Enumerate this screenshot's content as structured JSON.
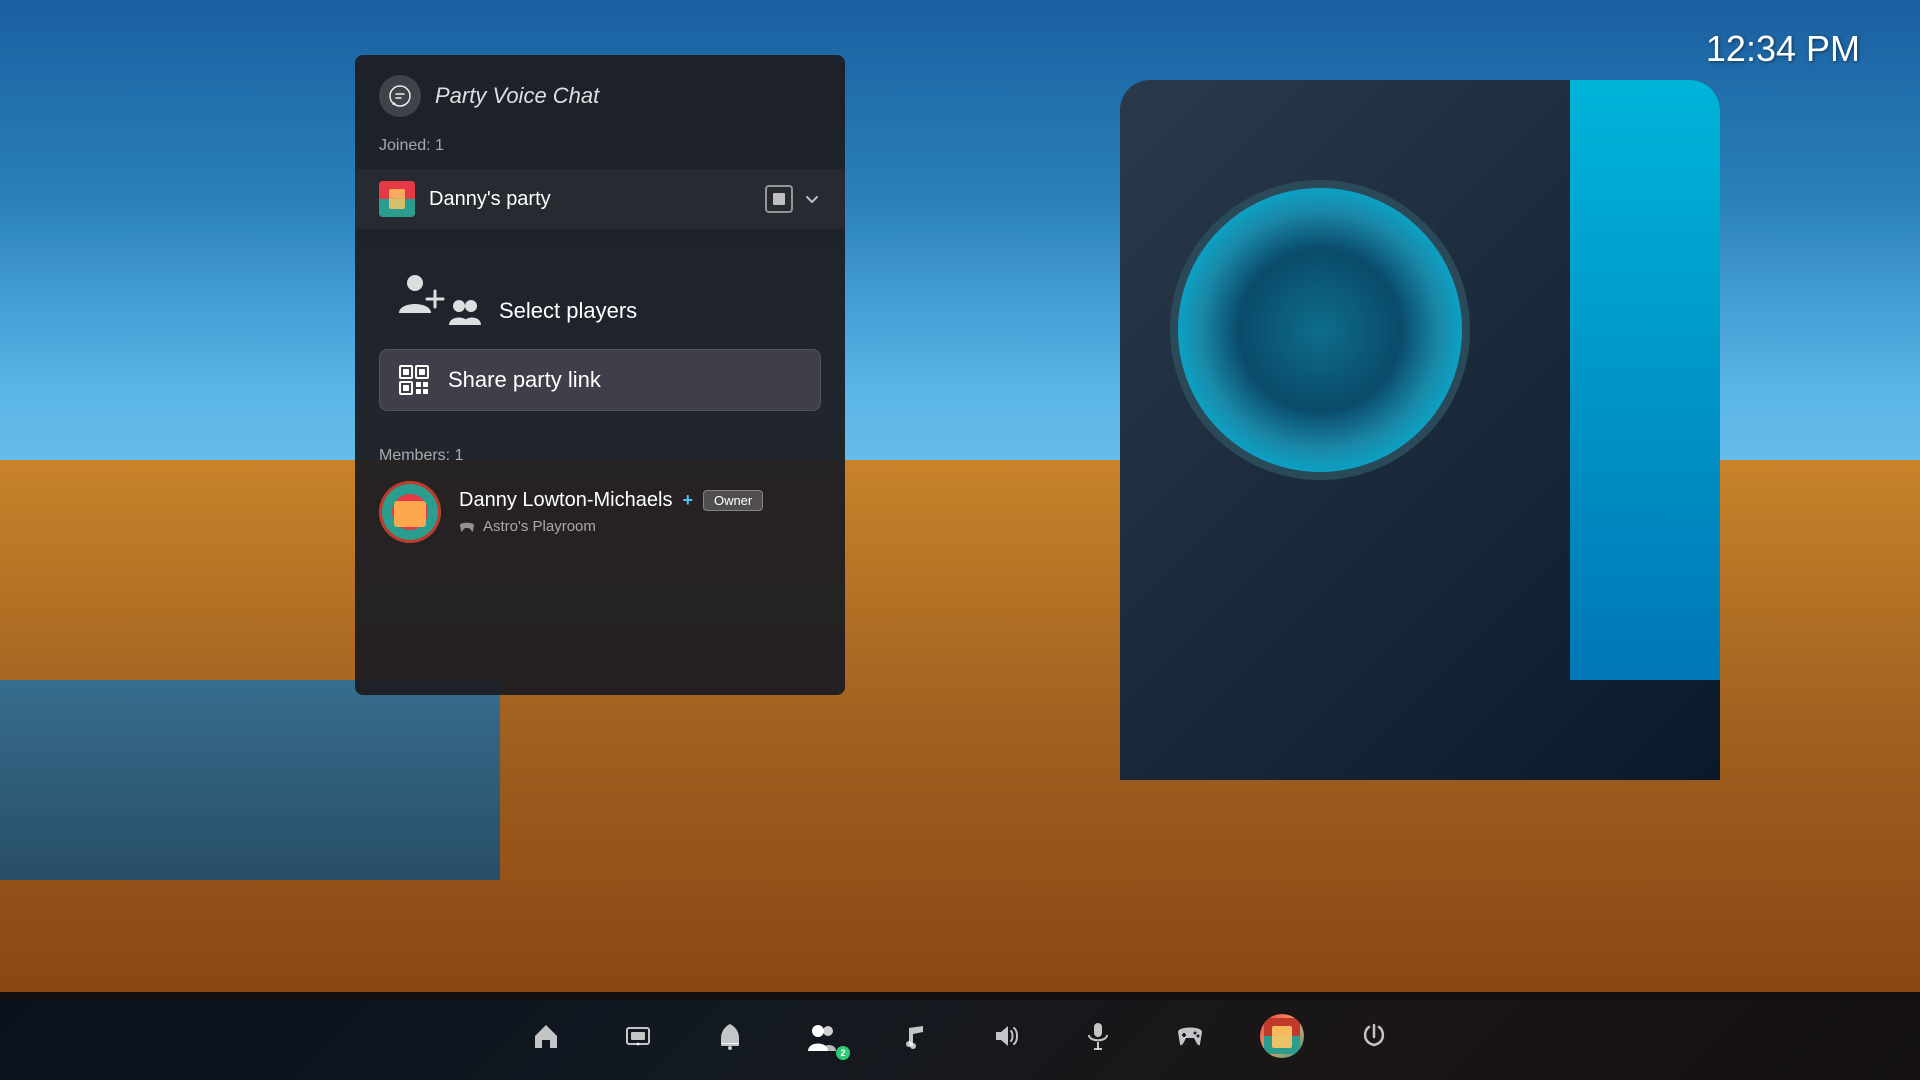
{
  "clock": {
    "time": "12:34 PM"
  },
  "panel": {
    "title": "Party Voice Chat",
    "joined_label": "Joined: 1",
    "party_name": "Danny's party",
    "members_label": "Members: 1",
    "actions": {
      "select_players": "Select players",
      "share_party_link": "Share party link"
    },
    "member": {
      "name": "Danny Lowton-Michaels",
      "psplus_symbol": "+",
      "owner_badge": "Owner",
      "game": "Astro's Playroom"
    }
  },
  "taskbar": {
    "badge_count": "2",
    "items": [
      {
        "id": "home",
        "label": "Home"
      },
      {
        "id": "game-library",
        "label": "Game Library"
      },
      {
        "id": "notifications",
        "label": "Notifications"
      },
      {
        "id": "party",
        "label": "Party",
        "active": true
      },
      {
        "id": "music",
        "label": "Music"
      },
      {
        "id": "sound",
        "label": "Sound"
      },
      {
        "id": "mic",
        "label": "Microphone"
      },
      {
        "id": "gamepad",
        "label": "Gamepad"
      },
      {
        "id": "profile",
        "label": "Profile"
      },
      {
        "id": "power",
        "label": "Power"
      }
    ]
  }
}
